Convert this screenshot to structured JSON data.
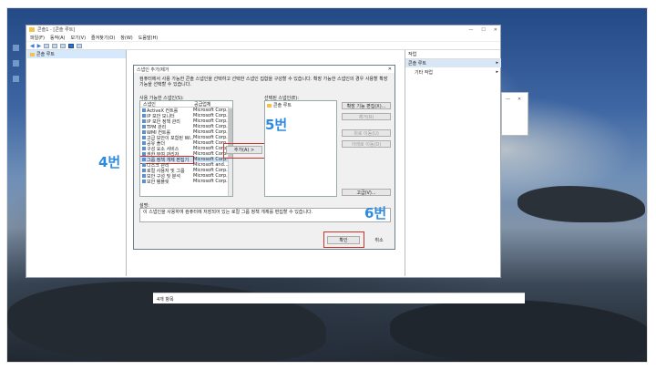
{
  "mmc": {
    "title": "콘솔1 - [콘솔 루트]",
    "window_controls": [
      "—",
      "☐",
      "✕"
    ],
    "menu": [
      "파일(F)",
      "동작(A)",
      "보기(V)",
      "즐겨찾기(O)",
      "창(W)",
      "도움말(H)"
    ],
    "tree_root": "콘솔 루트",
    "actions": {
      "header": "작업",
      "section": "콘솔 루트",
      "more": "기타 작업",
      "arrow": "▸"
    },
    "status": "4개 항목"
  },
  "dialog": {
    "title": "스냅인 추가/제거",
    "close": "✕",
    "description": "컴퓨터에서 사용 가능한 콘솔 스냅인을 선택하고 선택한 스냅인 집합을 구성할 수 있습니다. 확장 가능한 스냅인의 경우 사용할 확장 기능을 선택할 수 있습니다.",
    "available_label": "사용 가능한 스냅인(S):",
    "selected_label": "선택된 스냅인(E):",
    "columns": [
      "스냅인",
      "공급업체"
    ],
    "snapins": [
      {
        "name": "ActiveX 컨트롤",
        "vendor": "Microsoft Corp..."
      },
      {
        "name": "IP 보안 모니터",
        "vendor": "Microsoft Corp..."
      },
      {
        "name": "IP 보안 정책 관리",
        "vendor": "Microsoft Corp..."
      },
      {
        "name": "TPM 관리",
        "vendor": "Microsoft Corp..."
      },
      {
        "name": "WMI 컨트롤",
        "vendor": "Microsoft Corp..."
      },
      {
        "name": "고급 보안이 포함된 Wi...",
        "vendor": "Microsoft Corp..."
      },
      {
        "name": "공유 폴더",
        "vendor": "Microsoft Corp..."
      },
      {
        "name": "구성 요소 서비스",
        "vendor": "Microsoft Corp..."
      },
      {
        "name": "권한 부여 관리자",
        "vendor": "Microsoft Corp..."
      },
      {
        "name": "그룹 정책 개체 편집기",
        "vendor": "Microsoft Corp..."
      },
      {
        "name": "디스크 관리",
        "vendor": "Microsoft and..."
      },
      {
        "name": "로컬 사용자 및 그룹",
        "vendor": "Microsoft Corp..."
      },
      {
        "name": "보안 구성 및 분석",
        "vendor": "Microsoft Corp..."
      },
      {
        "name": "보안 템플릿",
        "vendor": "Microsoft Corp..."
      }
    ],
    "selected_index": 9,
    "selected_root": "콘솔 루트",
    "add_button": "추가(A) >",
    "edit_extensions": "확장 기능 편집(X)...",
    "remove": "제거(R)",
    "move_up": "위로 이동(U)",
    "move_down": "아래로 이동(D)",
    "advanced": "고급(V)...",
    "desc_label": "설명:",
    "desc_text": "이 스냅인을 사용하여 컴퓨터에 저장되어 있는 로컬 그룹 정책 개체를 편집할 수 있습니다.",
    "ok": "확인",
    "cancel": "취소"
  },
  "annotations": {
    "step4": "4번",
    "step5": "5번",
    "step6": "6번"
  },
  "colors": {
    "annotation": "#2f8be0",
    "highlight": "#c9342d",
    "selection": "#cfe3f8"
  }
}
